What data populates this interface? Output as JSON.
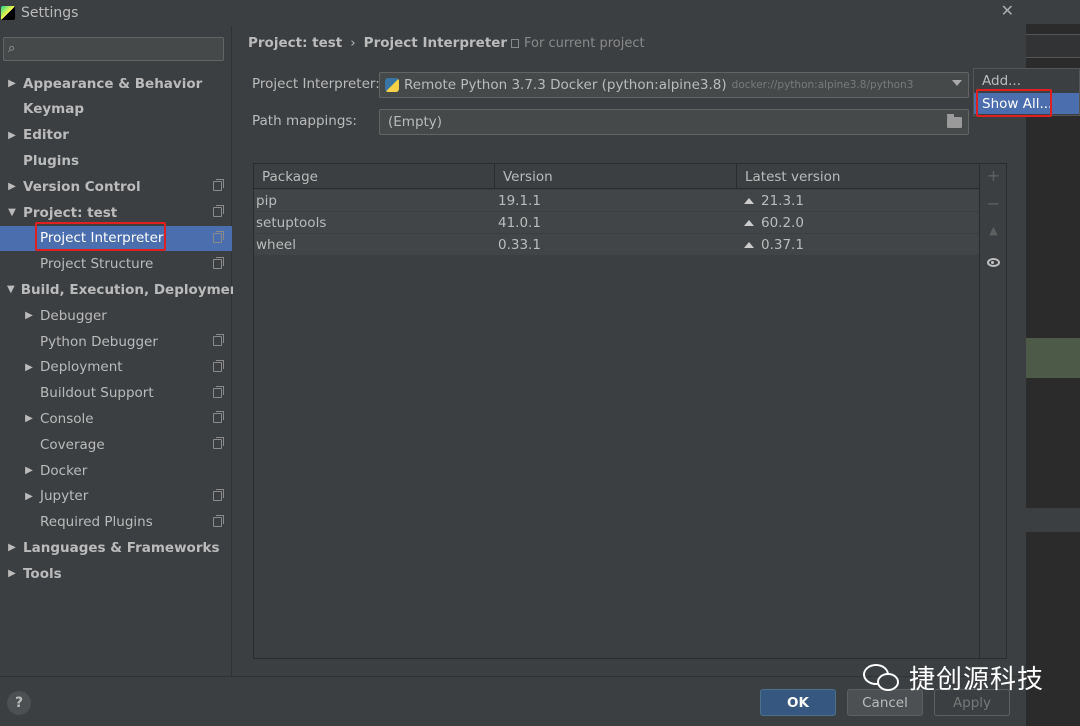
{
  "window": {
    "title": "Settings"
  },
  "sidebar": {
    "search_placeholder": "",
    "items": [
      {
        "label": "Appearance & Behavior",
        "arrow": "▶",
        "bold": true,
        "copy": false
      },
      {
        "label": "Keymap",
        "arrow": "",
        "bold": true,
        "copy": false
      },
      {
        "label": "Editor",
        "arrow": "▶",
        "bold": true,
        "copy": false
      },
      {
        "label": "Plugins",
        "arrow": "",
        "bold": true,
        "copy": false
      },
      {
        "label": "Version Control",
        "arrow": "▶",
        "bold": true,
        "copy": true
      },
      {
        "label": "Project: test",
        "arrow": "▼",
        "bold": true,
        "copy": true
      },
      {
        "label": "Project Interpreter",
        "arrow": "",
        "bold": false,
        "copy": true,
        "selected": true
      },
      {
        "label": "Project Structure",
        "arrow": "",
        "bold": false,
        "copy": true
      },
      {
        "label": "Build, Execution, Deployment",
        "arrow": "▼",
        "bold": true,
        "copy": false
      },
      {
        "label": "Debugger",
        "arrow": "▶",
        "bold": false,
        "copy": false
      },
      {
        "label": "Python Debugger",
        "arrow": "",
        "bold": false,
        "copy": true
      },
      {
        "label": "Deployment",
        "arrow": "▶",
        "bold": false,
        "copy": true
      },
      {
        "label": "Buildout Support",
        "arrow": "",
        "bold": false,
        "copy": true
      },
      {
        "label": "Console",
        "arrow": "▶",
        "bold": false,
        "copy": true
      },
      {
        "label": "Coverage",
        "arrow": "",
        "bold": false,
        "copy": true
      },
      {
        "label": "Docker",
        "arrow": "▶",
        "bold": false,
        "copy": false
      },
      {
        "label": "Jupyter",
        "arrow": "▶",
        "bold": false,
        "copy": true
      },
      {
        "label": "Required Plugins",
        "arrow": "",
        "bold": false,
        "copy": true
      },
      {
        "label": "Languages & Frameworks",
        "arrow": "▶",
        "bold": true,
        "copy": false
      },
      {
        "label": "Tools",
        "arrow": "▶",
        "bold": true,
        "copy": false
      }
    ]
  },
  "breadcrumb": {
    "parent": "Project: test",
    "separator": "›",
    "current": "Project Interpreter",
    "scope": "For current project"
  },
  "interpreter": {
    "label": "Project Interpreter:",
    "value": "Remote Python 3.7.3 Docker (python:alpine3.8)",
    "path": "docker://python:alpine3.8/python3"
  },
  "path_mappings": {
    "label": "Path mappings:",
    "value": "(Empty)"
  },
  "popup": {
    "items": [
      {
        "label": "Add..."
      },
      {
        "label": "Show All..."
      }
    ]
  },
  "table": {
    "columns": [
      "Package",
      "Version",
      "Latest version"
    ],
    "rows": [
      {
        "package": "pip",
        "version": "19.1.1",
        "latest": "21.3.1"
      },
      {
        "package": "setuptools",
        "version": "41.0.1",
        "latest": "60.2.0"
      },
      {
        "package": "wheel",
        "version": "0.33.1",
        "latest": "0.37.1"
      }
    ],
    "tools": {
      "add": "+",
      "remove": "−",
      "upgrade": "▲"
    }
  },
  "footer": {
    "help": "?",
    "ok": "OK",
    "cancel": "Cancel",
    "apply": "Apply"
  },
  "watermark": {
    "text": "捷创源科技"
  },
  "colors": {
    "selection": "#4b6eaf",
    "highlight_box": "#e02020",
    "primary_button": "#365880"
  }
}
